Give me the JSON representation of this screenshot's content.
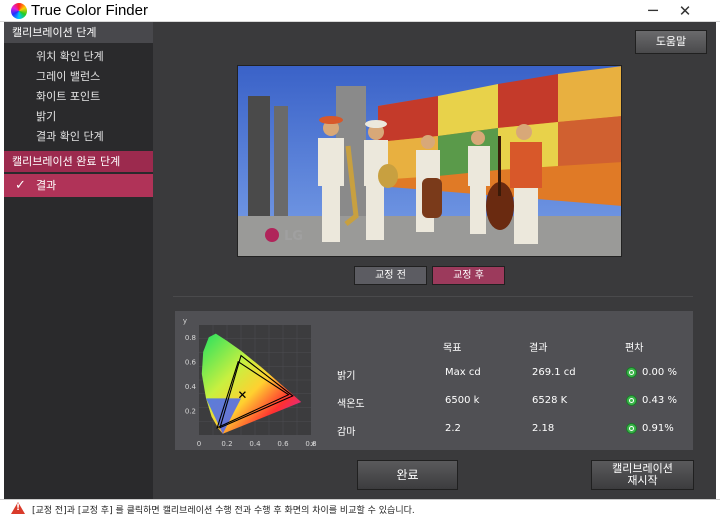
{
  "window": {
    "title": "True Color Finder",
    "minimize_glyph": "─",
    "close_glyph": "✕"
  },
  "sidebar": {
    "section1_title": "캘리브레이션 단계",
    "section1_items": [
      "위치 확인 단계",
      "그레이 밸런스",
      "화이트 포인트",
      "밝기",
      "결과 확인 단계"
    ],
    "section2_title": "캘리브레이션 완료 단계",
    "section2_items": [
      "결과"
    ]
  },
  "header": {
    "help_label": "도움말"
  },
  "preview": {
    "before_label": "교정 전",
    "after_label": "교정 후",
    "watermark": "LG"
  },
  "results": {
    "headers": {
      "target": "목표",
      "result": "결과",
      "deviation": "편차"
    },
    "rows": [
      {
        "label": "밝기",
        "target": "Max cd",
        "result": "269.1 cd",
        "deviation": "0.00 %"
      },
      {
        "label": "색온도",
        "target": "6500 k",
        "result": "6528 K",
        "deviation": "0.43 %"
      },
      {
        "label": "감마",
        "target": "2.2",
        "result": "2.18",
        "deviation": "0.91%"
      }
    ]
  },
  "chart_data": {
    "type": "scatter",
    "xlabel": "x",
    "ylabel": "y",
    "xticks": [
      "0",
      "0.2",
      "0.4",
      "0.6",
      "0.8"
    ],
    "yticks": [
      "0.2",
      "0.4",
      "0.6",
      "0.8"
    ],
    "xlim": [
      0,
      0.8
    ],
    "ylim": [
      0,
      0.9
    ],
    "grid": true,
    "series": [
      {
        "kind": "triangle",
        "color": "#000000",
        "points": [
          [
            0.28,
            0.6
          ],
          [
            0.13,
            0.06
          ],
          [
            0.64,
            0.33
          ]
        ]
      },
      {
        "kind": "triangle",
        "color": "#000000",
        "points": [
          [
            0.3,
            0.65
          ],
          [
            0.15,
            0.06
          ],
          [
            0.67,
            0.32
          ]
        ]
      },
      {
        "kind": "point",
        "marker": "x",
        "points": [
          [
            0.31,
            0.33
          ]
        ]
      }
    ]
  },
  "footer": {
    "done_label": "완료",
    "recalibrate_line1": "캘리브레이션",
    "recalibrate_line2": "재시작",
    "status_text": "[교정 전]과 [교정 후] 를 클릭하면 캘리브레이션 수행 전과 수행 후 화면의 차이를 비교할 수 있습니다.",
    "warning_mark": "!"
  },
  "colors": {
    "sidebar_bg": "#2a2a2c",
    "main_bg": "#3a3a3c",
    "accent": "#b03358",
    "ok_green": "#3bb54a"
  }
}
